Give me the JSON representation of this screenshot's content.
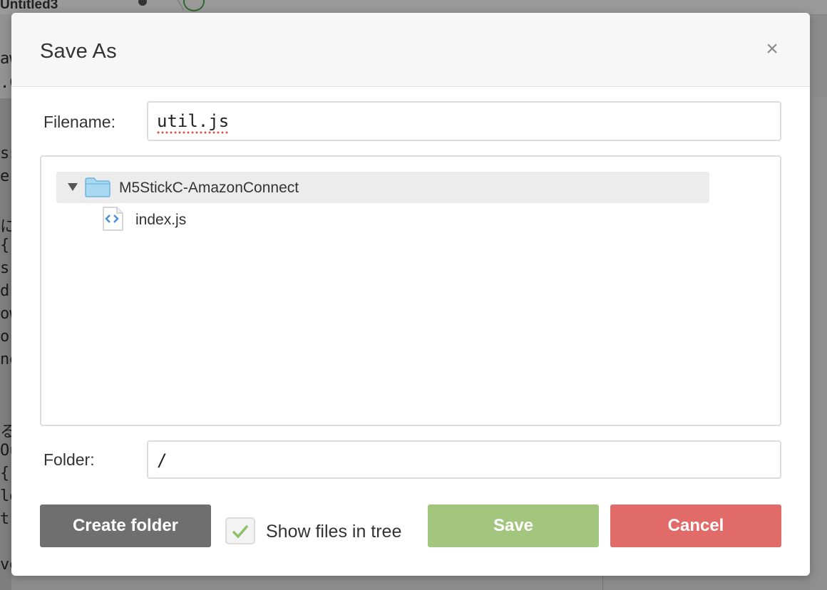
{
  "background": {
    "tab_title": "Untitled3",
    "code_fragments": [
      "aw",
      ".C",
      "ss",
      "e(",
      "に",
      "{",
      "s:",
      "d:",
      "ow",
      "or",
      "ne",
      "る",
      "Ou",
      "{",
      "le",
      "t(",
      "ve"
    ]
  },
  "dialog": {
    "title": "Save As",
    "close_glyph": "×",
    "filename_label": "Filename:",
    "filename_value": "util.js",
    "folder_label": "Folder:",
    "folder_value": "/",
    "tree": {
      "folder_name": "M5StickC-AmazonConnect",
      "files": [
        "index.js"
      ]
    },
    "create_folder_label": "Create folder",
    "show_files_label": "Show files in tree",
    "show_files_checked": true,
    "save_label": "Save",
    "cancel_label": "Cancel"
  },
  "colors": {
    "save": "#a3c67e",
    "cancel": "#e06b69",
    "create_folder": "#6f6f6f",
    "folder_icon": "#a9d8f3"
  }
}
